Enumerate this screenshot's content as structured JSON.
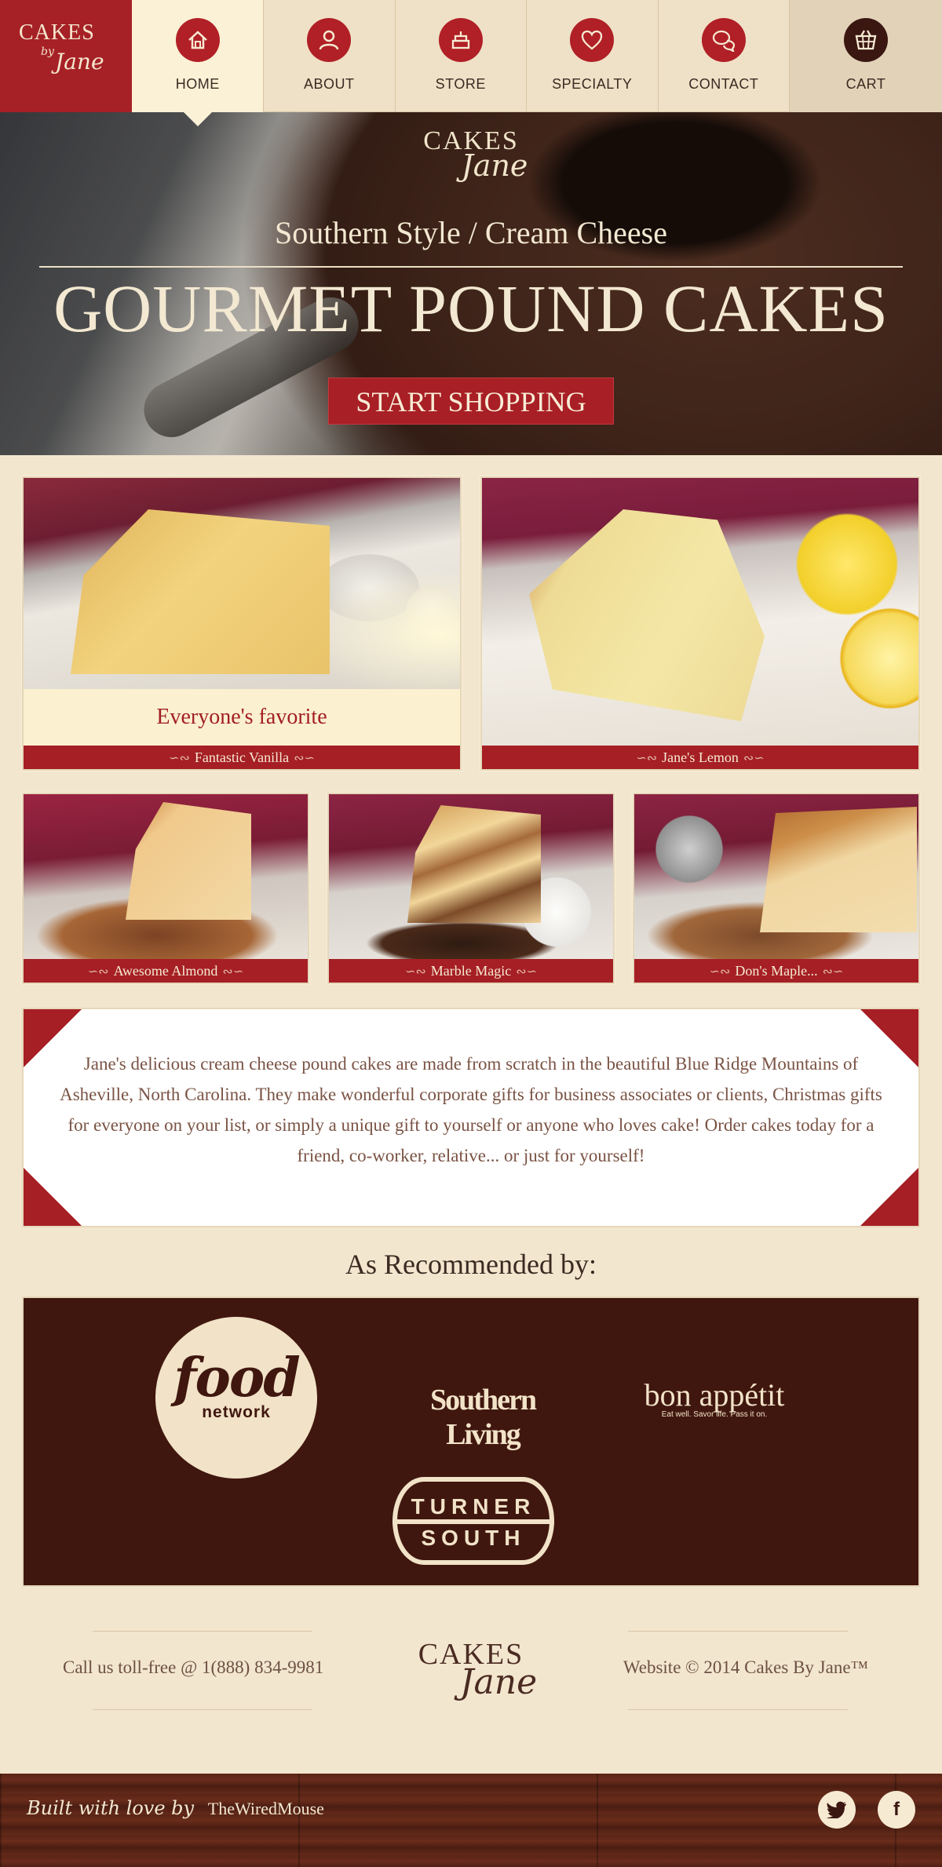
{
  "brand": {
    "line1": "CAKES",
    "line2": "Jane",
    "by": "by"
  },
  "nav": {
    "items": [
      {
        "label": "HOME",
        "icon": "house-icon"
      },
      {
        "label": "ABOUT",
        "icon": "person-icon"
      },
      {
        "label": "STORE",
        "icon": "cake-icon"
      },
      {
        "label": "SPECIALTY",
        "icon": "heart-icon"
      },
      {
        "label": "CONTACT",
        "icon": "chat-bubbles-icon"
      },
      {
        "label": "CART",
        "icon": "basket-icon"
      }
    ],
    "active": "HOME"
  },
  "hero": {
    "logo_line1": "CAKES",
    "logo_line2": "Jane",
    "subtitle": "Southern Style / Cream Cheese",
    "title": "GOURMET POUND CAKES",
    "button": "START SHOPPING"
  },
  "products": [
    {
      "name": "Fantastic Vanilla",
      "caption": "Everyone's favorite"
    },
    {
      "name": "Jane's Lemon"
    },
    {
      "name": "Awesome Almond"
    },
    {
      "name": "Marble Magic"
    },
    {
      "name": "Don's Maple..."
    }
  ],
  "about": {
    "text": "Jane's delicious cream cheese pound cakes are made from scratch in the beautiful Blue Ridge Mountains of Asheville, North Carolina. They make wonderful corporate gifts for business associates or clients, Christmas gifts for everyone on your list, or simply a unique gift to yourself or anyone who loves cake! Order cakes today for a friend, co-worker, relative... or just for yourself!"
  },
  "recommended": {
    "title": "As Recommended by:",
    "food_network": {
      "line1": "food",
      "line2": "network"
    },
    "southern_living": "Southern Living",
    "bon_appetit": {
      "line1": "bon appétit",
      "line2": "Eat well. Savor life.        Pass it on."
    },
    "turner_south": {
      "line1": "TURNER",
      "line2": "SOUTH"
    }
  },
  "footer": {
    "phone": "Call us toll-free @ 1(888) 834-9981",
    "copyright": "Website © 2014 Cakes By Jane™",
    "logo_line1": "CAKES",
    "logo_line2": "Jane",
    "built_with": "Built with love by",
    "builder": "TheWiredMouse",
    "twitter_icon": "twitter-icon",
    "facebook_icon": "facebook-icon"
  },
  "colors": {
    "brand_red": "#a51f24",
    "dark_brown": "#40170f",
    "cream": "#f3e6cf"
  }
}
